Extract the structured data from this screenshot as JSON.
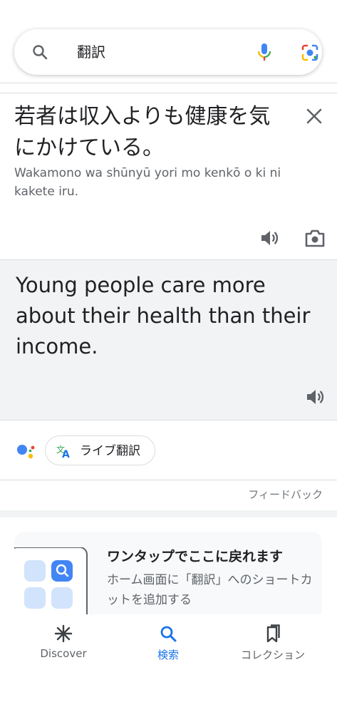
{
  "search": {
    "query": "翻訳"
  },
  "source": {
    "text": "若者は収入よりも健康を気にかけている。",
    "transliteration": "Wakamono wa shūnyū yori mo kenkō o ki ni kakete iru."
  },
  "target": {
    "text": "Young people care more about their health than their income."
  },
  "live_translate": {
    "label": "ライブ翻訳"
  },
  "feedback": {
    "label": "フィードバック"
  },
  "promo": {
    "title": "ワンタップでここに戻れます",
    "description": "ホーム画面に「翻訳」へのショートカットを追加する"
  },
  "bottom_nav": {
    "items": [
      {
        "label": "Discover",
        "icon": "asterisk-icon",
        "active": false
      },
      {
        "label": "検索",
        "icon": "search-icon",
        "active": true
      },
      {
        "label": "コレクション",
        "icon": "bookmark-icon",
        "active": false
      }
    ]
  },
  "colors": {
    "accent": "#1a73e8",
    "panel_bg": "#f1f3f4",
    "text": "#202124",
    "secondary_text": "#5f6368"
  }
}
